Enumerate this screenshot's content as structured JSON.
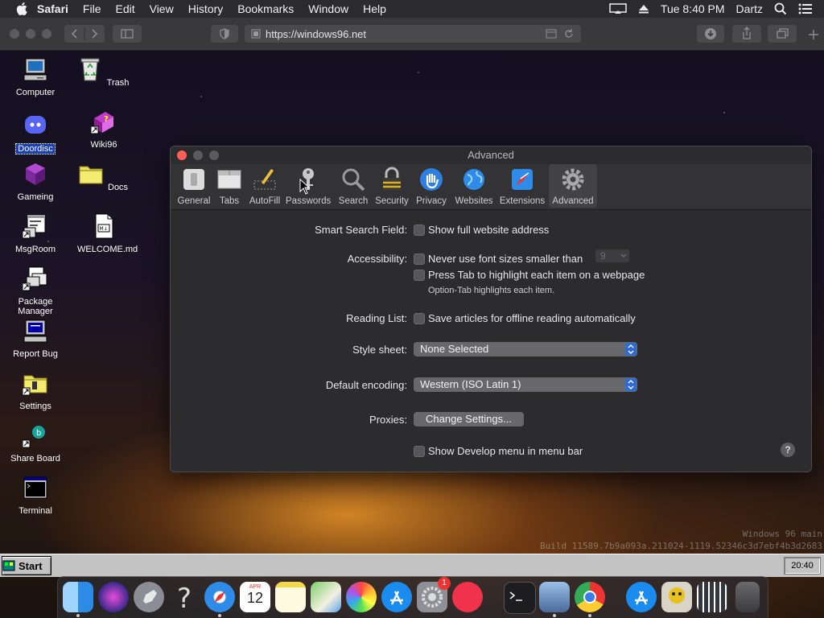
{
  "menubar": {
    "app": "Safari",
    "items": [
      "File",
      "Edit",
      "View",
      "History",
      "Bookmarks",
      "Window",
      "Help"
    ],
    "clock": "Tue 8:40 PM",
    "user": "Dartz"
  },
  "toolbar": {
    "url": "https://windows96.net"
  },
  "desktop": {
    "icons": [
      {
        "label": "Computer"
      },
      {
        "label": "Trash"
      },
      {
        "label": "Doordisc"
      },
      {
        "label": "Wiki96"
      },
      {
        "label": "Gameing"
      },
      {
        "label": "Docs"
      },
      {
        "label": "MsgRoom"
      },
      {
        "label": "WELCOME.md"
      },
      {
        "label": "Package Manager"
      },
      {
        "label": "Report Bug"
      },
      {
        "label": "Settings"
      },
      {
        "label": "Share Board"
      },
      {
        "label": "Terminal"
      }
    ]
  },
  "watermark": {
    "line1": "Windows 96 main",
    "line2": "Build 11589.7b9a093a.211024-1119.52346c3d7ebf4b3d2683"
  },
  "taskbar": {
    "start": "Start",
    "clock": "20:40"
  },
  "dock": {
    "calendar_month": "APR",
    "calendar_day": "12",
    "badge": "1"
  },
  "prefs": {
    "title": "Advanced",
    "tabs": [
      {
        "label": "General"
      },
      {
        "label": "Tabs"
      },
      {
        "label": "AutoFill"
      },
      {
        "label": "Passwords"
      },
      {
        "label": "Search"
      },
      {
        "label": "Security"
      },
      {
        "label": "Privacy"
      },
      {
        "label": "Websites"
      },
      {
        "label": "Extensions"
      },
      {
        "label": "Advanced"
      }
    ],
    "smart_search_label": "Smart Search Field:",
    "smart_search_option": "Show full website address",
    "accessibility_label": "Accessibility:",
    "font_size_option": "Never use font sizes smaller than",
    "font_size_value": "9",
    "tab_highlight_option": "Press Tab to highlight each item on a webpage",
    "tab_highlight_note": "Option-Tab highlights each item.",
    "reading_list_label": "Reading List:",
    "reading_list_option": "Save articles for offline reading automatically",
    "style_sheet_label": "Style sheet:",
    "style_sheet_value": "None Selected",
    "encoding_label": "Default encoding:",
    "encoding_value": "Western (ISO Latin 1)",
    "proxies_label": "Proxies:",
    "proxies_button": "Change Settings...",
    "develop_option": "Show Develop menu in menu bar",
    "help_glyph": "?"
  }
}
